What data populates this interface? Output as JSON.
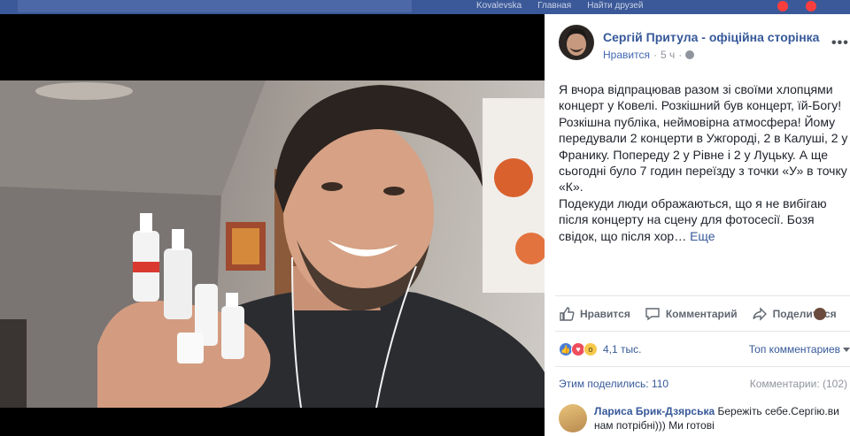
{
  "topbar": {
    "search_placeholder": "",
    "nav_items": [
      "Kovalevska",
      "Главная",
      "Найти друзей"
    ]
  },
  "post": {
    "page_name": "Сергій Притула - офіційна сторінка",
    "like_label": "Нравится",
    "time": "5 ч",
    "paragraph1": "Я вчора відпрацював разом зі своїми хлопцями концерт у Ковелі. Розкішний був концерт, їй-Богу! Розкішна публіка, неймовірна атмосфера! Йому передували 2 концерти в Ужгороді, 2 в Калуші, 2 у Франику. Попереду 2 у Рівне і 2 у Луцьку. А ще сьогодні було 7 годин переїзду з точки «У» в точку «К».",
    "paragraph2": "Подекуди люди ображаються, що я не вибігаю після концерту на сцену для фотосесії. Бозя свідок, що після хор…",
    "see_more": "Еще"
  },
  "actions": {
    "like": "Нравится",
    "comment": "Комментарий",
    "share": "Поделиться"
  },
  "stats": {
    "reactions_count": "4,1 тыс.",
    "top_comments": "Топ комментариев",
    "shares": "Этим поделились: 110",
    "comments": "Комментарии: (102)"
  },
  "comment": {
    "author": "Лариса Брик-Дзярська",
    "text": "Бережіть себе.Сергію.ви нам потрібні))) Ми готові"
  },
  "colors": {
    "fb_blue": "#365899",
    "topbar": "#3b5998",
    "meta_gray": "#90949c"
  }
}
